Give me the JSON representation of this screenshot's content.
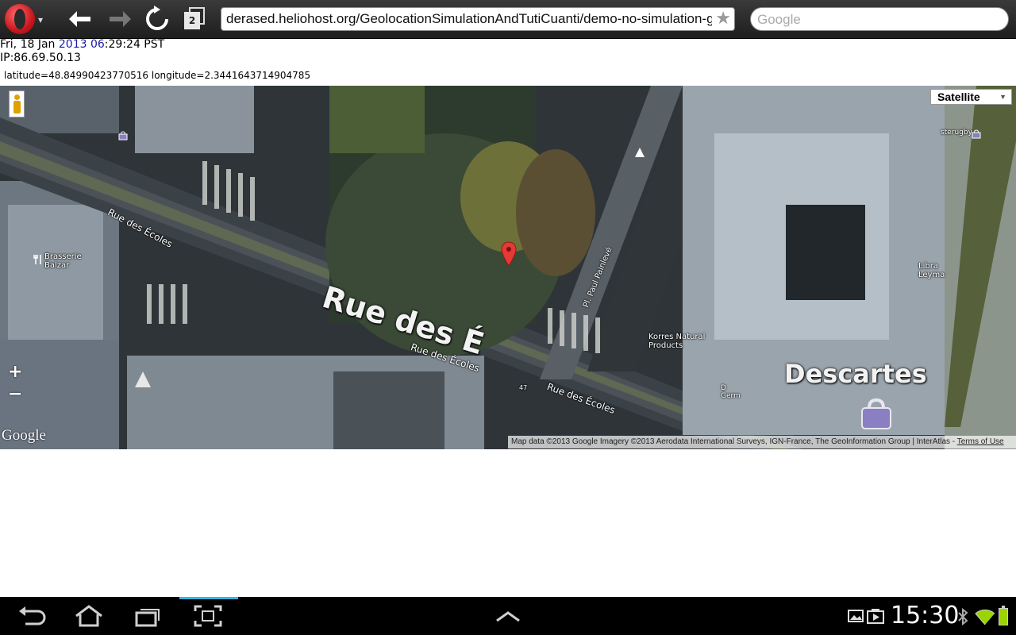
{
  "browser": {
    "url": "derased.heliohost.org/GeolocationSimulationAndTutiCuanti/demo-no-simulation-gma",
    "tab_count": "2",
    "search_placeholder": "Google"
  },
  "page": {
    "date_prefix": "Fri, 18 Jan ",
    "date_highlight": "2013 06",
    "date_suffix": ":29:24 PST",
    "ip": "IP:86.69.50.13",
    "coords": "latitude=48.84990423770516 longitude=2.3441643714904785"
  },
  "map": {
    "map_type": "Satellite",
    "zoom_in": "+",
    "zoom_out": "−",
    "logo": "Google",
    "attribution": "Map data ©2013 Google Imagery ©2013 Aerodata International Surveys, IGN-France, The GeoInformation Group | InterAtlas - ",
    "terms": "Terms of Use",
    "labels": {
      "street_top_left": "Rue des Écoles",
      "street_center": "Rue des Écoles",
      "street_right": "Rue des Écoles",
      "street_big": "Rue des É",
      "place": "Pl. Paul Painlevé",
      "brasserie": "Brasserie\nBalzar",
      "korres": "Korres Natural\nProducts",
      "descartes": "Descartes",
      "sterugby": "sterugby",
      "library": "Libra\nLeyma",
      "number_47": "47",
      "d_germ": "D\nGerm"
    }
  },
  "system": {
    "time": "15:30"
  },
  "colors": {
    "accent": "#33b5e5",
    "date_highlight": "#1a1aa6",
    "marker": "#e53935",
    "battery": "#9bd400"
  },
  "icons": [
    "opera-menu-icon",
    "back-arrow-icon",
    "forward-arrow-icon",
    "reload-icon",
    "tabs-icon",
    "bookmark-star-icon",
    "pegman-icon",
    "zoom-in-icon",
    "zoom-out-icon",
    "map-marker-icon",
    "android-back-icon",
    "android-home-icon",
    "android-recent-apps-icon",
    "screenshot-icon",
    "expand-up-icon",
    "gallery-notification-icon",
    "media-notification-icon",
    "bluetooth-icon",
    "wifi-icon",
    "battery-icon"
  ]
}
